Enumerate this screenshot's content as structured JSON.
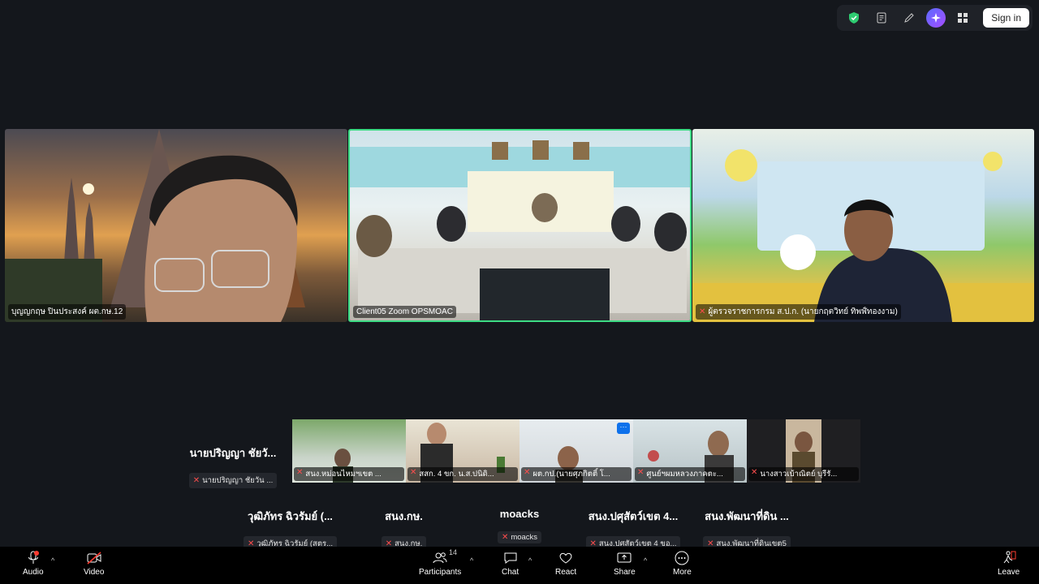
{
  "top_toolbar": {
    "signin_label": "Sign in",
    "icons": [
      "shield-icon",
      "notes-icon",
      "pen-icon",
      "ai-companion-icon",
      "apps-grid-icon"
    ]
  },
  "main_tiles": [
    {
      "name": "บุญญกฤษ ปินประสงค์ ผต.กษ.12"
    },
    {
      "name": "Client05 Zoom OPSMOAC"
    },
    {
      "name": "ผู้ตรวจราชการกรม ส.ป.ก. (นายกฤตวิทย์ ทิพฬ์ทองงาม)"
    }
  ],
  "gallery_header": "นายปริญญา ชัยวั...",
  "gallery_header_label": "นายปริญญา ชัยวัน ...",
  "gallery": [
    {
      "label": "สนง.หม่อนไหมฯเขต ..."
    },
    {
      "label": "สสก. 4 ขก. น.ส.ปนิดิ..."
    },
    {
      "label": "ผต.กป.(นายศุภกิตติ์ โ..."
    },
    {
      "label": "ศูนย์ฯผมหลวงภาคตะ..."
    },
    {
      "label": "นางสาวเบ้าณิตย์ บุรีรั..."
    }
  ],
  "name_tiles": [
    {
      "big": "วุฒิภัทร ฉิวรัมย์ (...",
      "small": "วุฒิภัทร ฉิวรัมย์ (สตร..."
    },
    {
      "big": "สนง.กษ.",
      "small": "สนง.กษ."
    },
    {
      "big": "moacks",
      "small": "moacks"
    },
    {
      "big": "สนง.ปศุสัตว์เขต 4...",
      "small": "สนง.ปศสัตว์เขต 4 ขอ..."
    },
    {
      "big": "สนง.พัฒนาที่ดิน ...",
      "small": "สนง.พัฒนาที่ดินเขต5"
    }
  ],
  "bottom_bar": {
    "audio": "Audio",
    "video": "Video",
    "participants": "Participants",
    "participants_count": "14",
    "chat": "Chat",
    "react": "React",
    "share": "Share",
    "more": "More",
    "leave": "Leave"
  },
  "colors": {
    "active_speaker_border": "#3ddc84",
    "muted_red": "#ff4d4d",
    "background": "#14171c"
  }
}
